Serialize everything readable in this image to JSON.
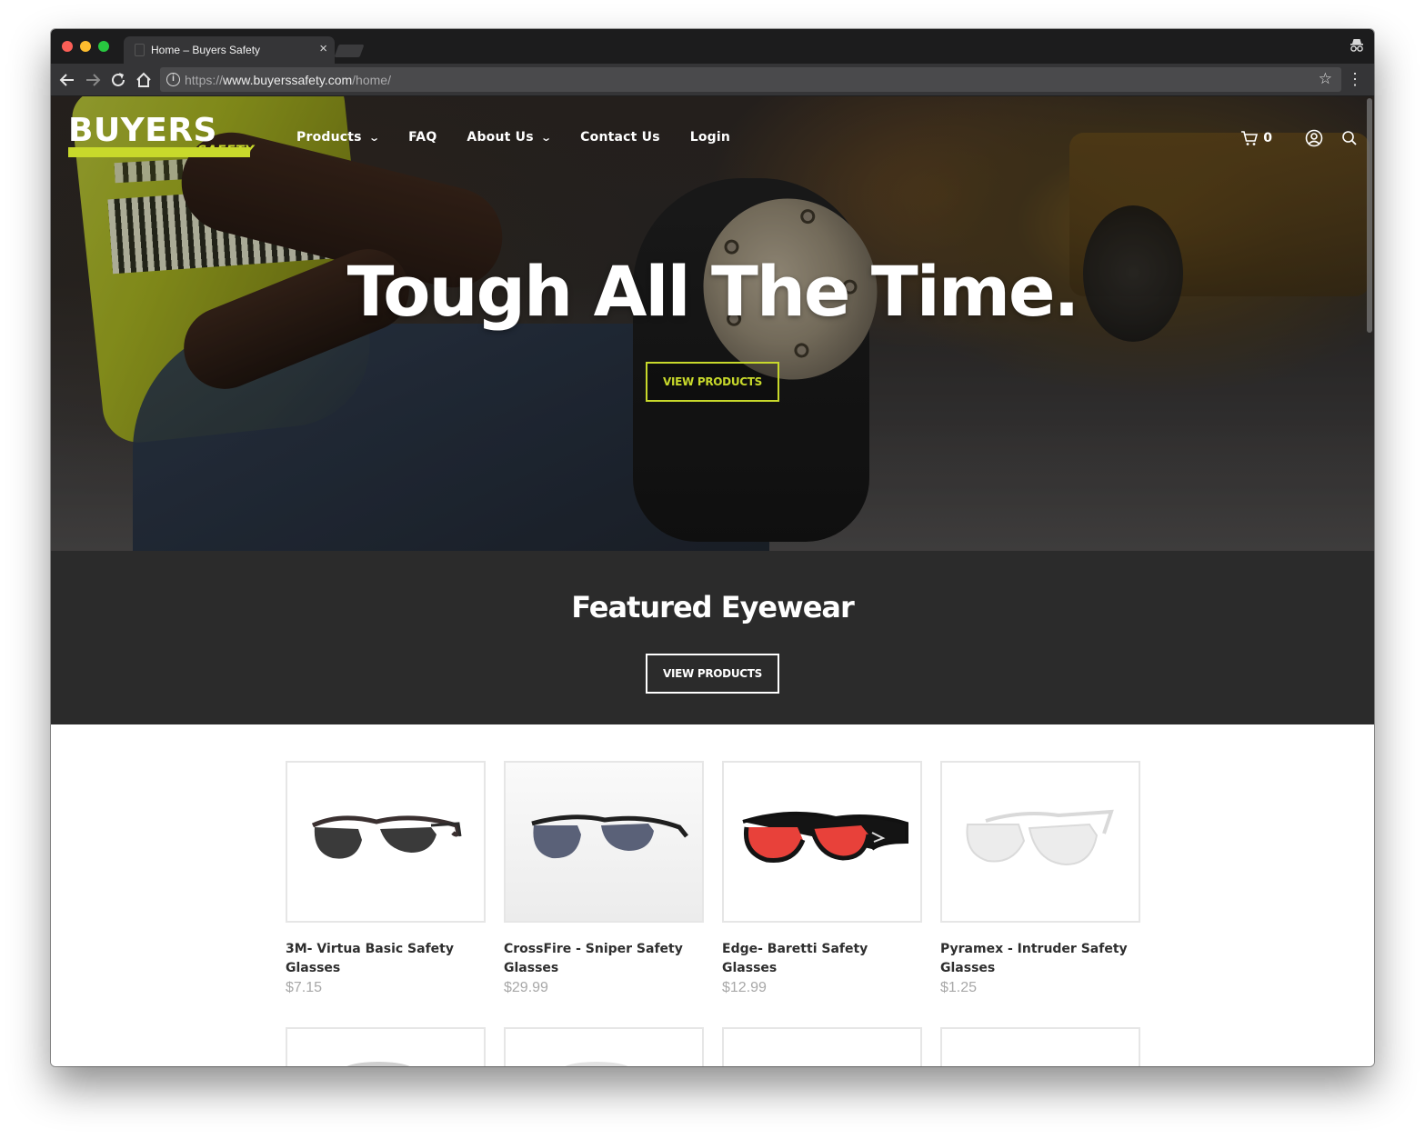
{
  "browser": {
    "tab_title": "Home – Buyers Safety",
    "url_scheme": "https://",
    "url_host": "www.buyerssafety.com",
    "url_path": "/home/",
    "icons": [
      "back-arrow-icon",
      "forward-arrow-icon",
      "reload-icon",
      "home-icon",
      "info-icon",
      "star-icon",
      "kebab-menu-icon",
      "incognito-icon",
      "tab-close-icon"
    ]
  },
  "site": {
    "logo": {
      "word": "BUYERS",
      "sub": "SAFETY"
    },
    "nav": [
      {
        "label": "Products",
        "dropdown": true
      },
      {
        "label": "FAQ",
        "dropdown": false
      },
      {
        "label": "About Us",
        "dropdown": true
      },
      {
        "label": "Contact Us",
        "dropdown": false
      },
      {
        "label": "Login",
        "dropdown": false
      }
    ],
    "cart_count": "0",
    "header_icons": [
      "cart-icon",
      "account-icon",
      "search-icon"
    ]
  },
  "hero": {
    "title": "Tough All The Time.",
    "button": "VIEW PRODUCTS"
  },
  "featured": {
    "title": "Featured Eyewear",
    "button": "VIEW PRODUCTS"
  },
  "products": [
    {
      "name": "3M- Virtua Basic Safety Glasses",
      "price": "$7.15",
      "lens_color": "#3a3a3a"
    },
    {
      "name": "CrossFire - Sniper Safety Glasses",
      "price": "$29.99",
      "lens_color": "#5a6178"
    },
    {
      "name": "Edge- Baretti Safety Glasses",
      "price": "$12.99",
      "lens_color": "#e8413a"
    },
    {
      "name": "Pyramex - Intruder Safety Glasses",
      "price": "$1.25",
      "lens_color": "#e9e9e9"
    }
  ],
  "colors": {
    "accent": "#c8d92b",
    "dark_band": "#2b2b2b",
    "price": "#a8a8a8"
  }
}
